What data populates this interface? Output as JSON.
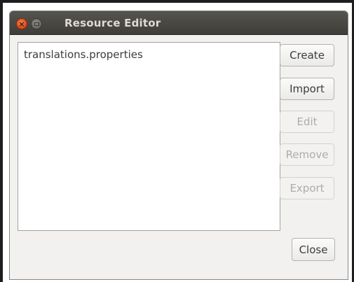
{
  "window": {
    "title": "Resource Editor",
    "close_glyph": "×"
  },
  "resource_list": {
    "items": [
      "translations.properties"
    ]
  },
  "buttons": {
    "create": {
      "label": "Create",
      "enabled": true
    },
    "import": {
      "label": "Import",
      "enabled": true
    },
    "edit": {
      "label": "Edit",
      "enabled": false
    },
    "remove": {
      "label": "Remove",
      "enabled": false
    },
    "export": {
      "label": "Export",
      "enabled": false
    },
    "close": {
      "label": "Close",
      "enabled": true
    }
  },
  "colors": {
    "titlebar": "#4a4843",
    "title_text": "#dfdbd2",
    "close_button": "#df4a16",
    "window_bg": "#f2f1f0",
    "disabled_text": "#aeaca8"
  },
  "icons": {
    "close": "close-icon",
    "minimize": "minimize-icon"
  }
}
